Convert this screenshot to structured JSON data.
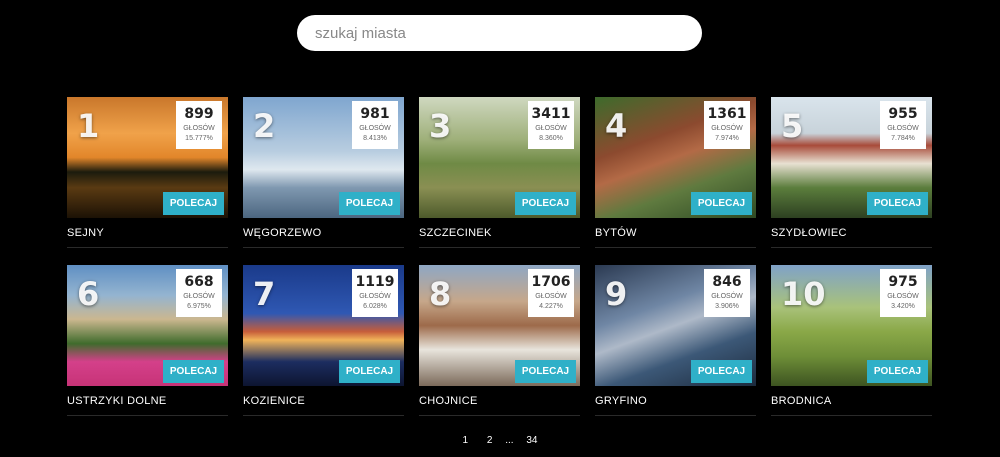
{
  "search": {
    "placeholder": "szukaj miasta"
  },
  "votes_label": "GŁOSÓW",
  "vote_button": "POLECAJ",
  "cities": [
    {
      "rank": "1",
      "name": "SEJNY",
      "votes": "899",
      "percent": "15.777%",
      "bg": "linear-gradient(180deg,#c9772b 0%,#f0a24a 30%,#e2862a 50%,#1b1b0d 62%,#5a3a12 75%,#1c1205 100%)"
    },
    {
      "rank": "2",
      "name": "WĘGORZEWO",
      "votes": "981",
      "percent": "8.413%",
      "bg": "linear-gradient(180deg,#7fa6cf 0%,#b8cde0 45%,#dfe8ef 60%,#7f98b0 75%,#4c6680 100%)"
    },
    {
      "rank": "3",
      "name": "SZCZECINEK",
      "votes": "3411",
      "percent": "8.360%",
      "bg": "linear-gradient(180deg,#cfd8c0 0%,#9fb07a 35%,#6f8a45 55%,#8a8f53 75%,#4d5a2b 100%)"
    },
    {
      "rank": "4",
      "name": "BYTÓW",
      "votes": "1361",
      "percent": "7.974%",
      "bg": "linear-gradient(160deg,#3d6b2c 0%,#8c4a2f 35%,#b36a46 50%,#5f7a3f 70%,#2e4a24 100%)"
    },
    {
      "rank": "5",
      "name": "SZYDŁOWIEC",
      "votes": "955",
      "percent": "7.784%",
      "bg": "linear-gradient(180deg,#d9e4ec 0%,#c8d3da 30%,#a84b3a 40%,#e8e1d2 55%,#5b7d3c 75%,#2d4021 100%)"
    },
    {
      "rank": "6",
      "name": "USTRZYKI DOLNE",
      "votes": "668",
      "percent": "6.975%",
      "bg": "linear-gradient(180deg,#5f8fc3 0%,#94b4d0 25%,#cbb78f 45%,#3f6b2c 65%,#d4408a 80%,#c73377 100%)"
    },
    {
      "rank": "7",
      "name": "KOZIENICE",
      "votes": "1119",
      "percent": "6.028%",
      "bg": "linear-gradient(180deg,#1a3a8a 0%,#2f58b3 40%,#c65d3a 55%,#f0b35a 62%,#1c2d60 80%,#0d1530 100%)"
    },
    {
      "rank": "8",
      "name": "CHOJNICE",
      "votes": "1706",
      "percent": "4.227%",
      "bg": "linear-gradient(180deg,#8ea7c4 0%,#c6a78a 30%,#9d6a4a 50%,#e8e4dc 70%,#7b6a5a 100%)"
    },
    {
      "rank": "9",
      "name": "GRYFINO",
      "votes": "846",
      "percent": "3.906%",
      "bg": "linear-gradient(160deg,#2b3a52 0%,#6f86a4 35%,#aeb9c8 50%,#3c5877 70%,#1c2a3c 100%)"
    },
    {
      "rank": "10",
      "name": "BRODNICA",
      "votes": "975",
      "percent": "3.420%",
      "bg": "linear-gradient(180deg,#7fa2c8 0%,#a9c27a 35%,#8aa848 55%,#6f8f38 75%,#3d5421 100%)"
    }
  ],
  "pagination": [
    "1",
    "2",
    "...",
    "34"
  ]
}
